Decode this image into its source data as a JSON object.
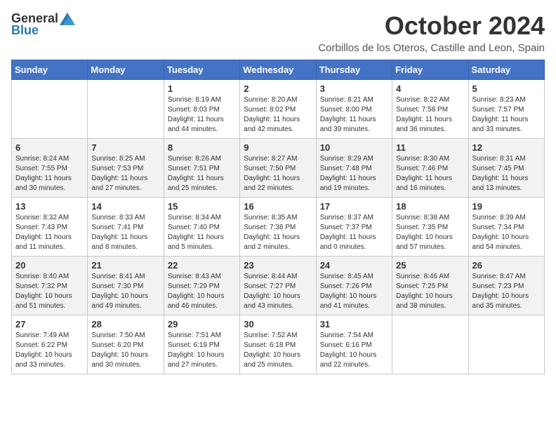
{
  "header": {
    "logo_general": "General",
    "logo_blue": "Blue",
    "month_title": "October 2024",
    "location": "Corbillos de los Oteros, Castille and Leon, Spain"
  },
  "weekdays": [
    "Sunday",
    "Monday",
    "Tuesday",
    "Wednesday",
    "Thursday",
    "Friday",
    "Saturday"
  ],
  "weeks": [
    [
      {
        "day": "",
        "info": ""
      },
      {
        "day": "",
        "info": ""
      },
      {
        "day": "1",
        "info": "Sunrise: 8:19 AM\nSunset: 8:03 PM\nDaylight: 11 hours and 44 minutes."
      },
      {
        "day": "2",
        "info": "Sunrise: 8:20 AM\nSunset: 8:02 PM\nDaylight: 11 hours and 42 minutes."
      },
      {
        "day": "3",
        "info": "Sunrise: 8:21 AM\nSunset: 8:00 PM\nDaylight: 11 hours and 39 minutes."
      },
      {
        "day": "4",
        "info": "Sunrise: 8:22 AM\nSunset: 7:58 PM\nDaylight: 11 hours and 36 minutes."
      },
      {
        "day": "5",
        "info": "Sunrise: 8:23 AM\nSunset: 7:57 PM\nDaylight: 11 hours and 33 minutes."
      }
    ],
    [
      {
        "day": "6",
        "info": "Sunrise: 8:24 AM\nSunset: 7:55 PM\nDaylight: 11 hours and 30 minutes."
      },
      {
        "day": "7",
        "info": "Sunrise: 8:25 AM\nSunset: 7:53 PM\nDaylight: 11 hours and 27 minutes."
      },
      {
        "day": "8",
        "info": "Sunrise: 8:26 AM\nSunset: 7:51 PM\nDaylight: 11 hours and 25 minutes."
      },
      {
        "day": "9",
        "info": "Sunrise: 8:27 AM\nSunset: 7:50 PM\nDaylight: 11 hours and 22 minutes."
      },
      {
        "day": "10",
        "info": "Sunrise: 8:29 AM\nSunset: 7:48 PM\nDaylight: 11 hours and 19 minutes."
      },
      {
        "day": "11",
        "info": "Sunrise: 8:30 AM\nSunset: 7:46 PM\nDaylight: 11 hours and 16 minutes."
      },
      {
        "day": "12",
        "info": "Sunrise: 8:31 AM\nSunset: 7:45 PM\nDaylight: 11 hours and 13 minutes."
      }
    ],
    [
      {
        "day": "13",
        "info": "Sunrise: 8:32 AM\nSunset: 7:43 PM\nDaylight: 11 hours and 11 minutes."
      },
      {
        "day": "14",
        "info": "Sunrise: 8:33 AM\nSunset: 7:41 PM\nDaylight: 11 hours and 8 minutes."
      },
      {
        "day": "15",
        "info": "Sunrise: 8:34 AM\nSunset: 7:40 PM\nDaylight: 11 hours and 5 minutes."
      },
      {
        "day": "16",
        "info": "Sunrise: 8:35 AM\nSunset: 7:38 PM\nDaylight: 11 hours and 2 minutes."
      },
      {
        "day": "17",
        "info": "Sunrise: 8:37 AM\nSunset: 7:37 PM\nDaylight: 11 hours and 0 minutes."
      },
      {
        "day": "18",
        "info": "Sunrise: 8:38 AM\nSunset: 7:35 PM\nDaylight: 10 hours and 57 minutes."
      },
      {
        "day": "19",
        "info": "Sunrise: 8:39 AM\nSunset: 7:34 PM\nDaylight: 10 hours and 54 minutes."
      }
    ],
    [
      {
        "day": "20",
        "info": "Sunrise: 8:40 AM\nSunset: 7:32 PM\nDaylight: 10 hours and 51 minutes."
      },
      {
        "day": "21",
        "info": "Sunrise: 8:41 AM\nSunset: 7:30 PM\nDaylight: 10 hours and 49 minutes."
      },
      {
        "day": "22",
        "info": "Sunrise: 8:43 AM\nSunset: 7:29 PM\nDaylight: 10 hours and 46 minutes."
      },
      {
        "day": "23",
        "info": "Sunrise: 8:44 AM\nSunset: 7:27 PM\nDaylight: 10 hours and 43 minutes."
      },
      {
        "day": "24",
        "info": "Sunrise: 8:45 AM\nSunset: 7:26 PM\nDaylight: 10 hours and 41 minutes."
      },
      {
        "day": "25",
        "info": "Sunrise: 8:46 AM\nSunset: 7:25 PM\nDaylight: 10 hours and 38 minutes."
      },
      {
        "day": "26",
        "info": "Sunrise: 8:47 AM\nSunset: 7:23 PM\nDaylight: 10 hours and 35 minutes."
      }
    ],
    [
      {
        "day": "27",
        "info": "Sunrise: 7:49 AM\nSunset: 6:22 PM\nDaylight: 10 hours and 33 minutes."
      },
      {
        "day": "28",
        "info": "Sunrise: 7:50 AM\nSunset: 6:20 PM\nDaylight: 10 hours and 30 minutes."
      },
      {
        "day": "29",
        "info": "Sunrise: 7:51 AM\nSunset: 6:19 PM\nDaylight: 10 hours and 27 minutes."
      },
      {
        "day": "30",
        "info": "Sunrise: 7:52 AM\nSunset: 6:18 PM\nDaylight: 10 hours and 25 minutes."
      },
      {
        "day": "31",
        "info": "Sunrise: 7:54 AM\nSunset: 6:16 PM\nDaylight: 10 hours and 22 minutes."
      },
      {
        "day": "",
        "info": ""
      },
      {
        "day": "",
        "info": ""
      }
    ]
  ]
}
